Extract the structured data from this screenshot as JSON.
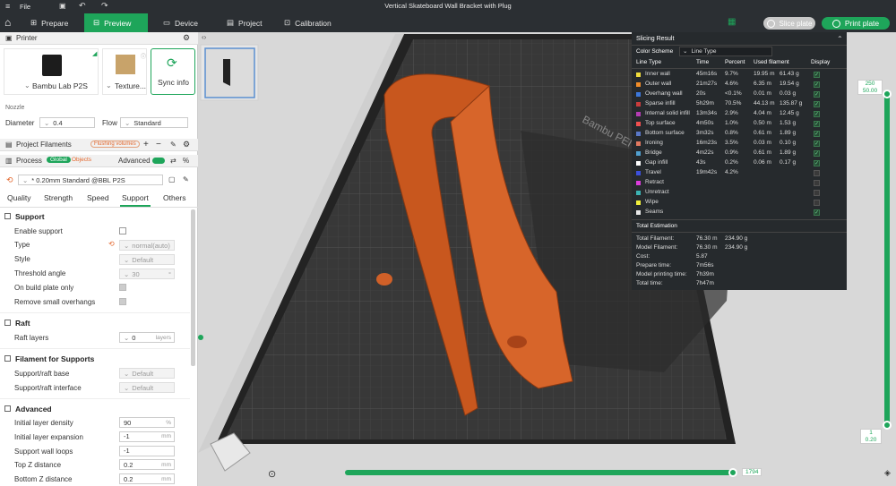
{
  "titlebar": {
    "title": "Vertical Skateboard Wall Bracket with Plug",
    "file_menu": "File"
  },
  "nav": {
    "tabs": [
      "Prepare",
      "Preview",
      "Device",
      "Project",
      "Calibration"
    ],
    "slice_plate": "Slice plate",
    "print_plate": "Print plate"
  },
  "printer": {
    "header": "Printer",
    "name": "Bambu Lab P2S",
    "plate": "Texture...",
    "sync": "Sync info",
    "nozzle_label": "Nozzle",
    "diameter_label": "Diameter",
    "diameter_value": "0.4",
    "flow_label": "Flow",
    "flow_value": "Standard"
  },
  "filaments": {
    "header": "Project Filaments",
    "flushing": "Flushing volumes",
    "add": "+",
    "remove": "−"
  },
  "process": {
    "header": "Process",
    "global": "Global",
    "objects": "Objects",
    "advanced": "Advanced",
    "preset": "* 0.20mm Standard @BBL P2S",
    "tabs": [
      "Quality",
      "Strength",
      "Speed",
      "Support",
      "Others"
    ]
  },
  "support": {
    "group": "Support",
    "enable": "Enable support",
    "type_label": "Type",
    "type_value": "normal(auto)",
    "style_label": "Style",
    "style_value": "Default",
    "threshold_label": "Threshold angle",
    "threshold_value": "30",
    "threshold_unit": "°",
    "build_plate": "On build plate only",
    "remove_small": "Remove small overhangs"
  },
  "raft": {
    "group": "Raft",
    "layers_label": "Raft layers",
    "layers_value": "0",
    "layers_unit": "layers"
  },
  "filament_supports": {
    "group": "Filament for Supports",
    "base_label": "Support/raft base",
    "base_value": "Default",
    "interface_label": "Support/raft interface",
    "interface_value": "Default"
  },
  "advanced": {
    "group": "Advanced",
    "rows": [
      {
        "label": "Initial layer density",
        "value": "90",
        "unit": "%"
      },
      {
        "label": "Initial layer expansion",
        "value": "-1",
        "unit": "mm"
      },
      {
        "label": "Support wall loops",
        "value": "-1",
        "unit": ""
      },
      {
        "label": "Top Z distance",
        "value": "0.2",
        "unit": "mm"
      },
      {
        "label": "Bottom Z distance",
        "value": "0.2",
        "unit": "mm"
      }
    ]
  },
  "slicing": {
    "title": "Slicing Result",
    "color_scheme_label": "Color Scheme",
    "color_scheme_value": "Line Type",
    "headers": [
      "Line Type",
      "Time",
      "Percent",
      "Used filament",
      "Display"
    ],
    "rows": [
      {
        "name": "Inner wall",
        "color": "#f0dc3c",
        "time": "45m16s",
        "percent": "9.7%",
        "len": "19.95 m",
        "weight": "61.43 g",
        "on": true
      },
      {
        "name": "Outer wall",
        "color": "#f08c28",
        "time": "21m27s",
        "percent": "4.6%",
        "len": "6.35 m",
        "weight": "19.54 g",
        "on": true
      },
      {
        "name": "Overhang wall",
        "color": "#3c78dc",
        "time": "20s",
        "percent": "<0.1%",
        "len": "0.01 m",
        "weight": "0.03 g",
        "on": true
      },
      {
        "name": "Sparse infill",
        "color": "#c83c3c",
        "time": "5h29m",
        "percent": "70.5%",
        "len": "44.13 m",
        "weight": "135.87 g",
        "on": true
      },
      {
        "name": "Internal solid infill",
        "color": "#b43cb4",
        "time": "13m34s",
        "percent": "2.9%",
        "len": "4.04 m",
        "weight": "12.45 g",
        "on": true
      },
      {
        "name": "Top surface",
        "color": "#f05050",
        "time": "4m50s",
        "percent": "1.0%",
        "len": "0.50 m",
        "weight": "1.53 g",
        "on": true
      },
      {
        "name": "Bottom surface",
        "color": "#5a78c8",
        "time": "3m32s",
        "percent": "0.8%",
        "len": "0.61 m",
        "weight": "1.89 g",
        "on": true
      },
      {
        "name": "Ironing",
        "color": "#e07860",
        "time": "16m23s",
        "percent": "3.5%",
        "len": "0.03 m",
        "weight": "0.10 g",
        "on": true
      },
      {
        "name": "Bridge",
        "color": "#50a0d0",
        "time": "4m22s",
        "percent": "0.9%",
        "len": "0.61 m",
        "weight": "1.89 g",
        "on": true
      },
      {
        "name": "Gap infill",
        "color": "#ffffff",
        "time": "43s",
        "percent": "0.2%",
        "len": "0.06 m",
        "weight": "0.17 g",
        "on": true
      },
      {
        "name": "Travel",
        "color": "#3c50dc",
        "time": "19m42s",
        "percent": "4.2%",
        "len": "",
        "weight": "",
        "on": false
      },
      {
        "name": "Retract",
        "color": "#dc3cdc",
        "time": "",
        "percent": "",
        "len": "",
        "weight": "",
        "on": false
      },
      {
        "name": "Unretract",
        "color": "#3cb4b4",
        "time": "",
        "percent": "",
        "len": "",
        "weight": "",
        "on": false
      },
      {
        "name": "Wipe",
        "color": "#f0f03c",
        "time": "",
        "percent": "",
        "len": "",
        "weight": "",
        "on": false
      },
      {
        "name": "Seams",
        "color": "#e8e8e8",
        "time": "",
        "percent": "",
        "len": "",
        "weight": "",
        "on": true
      }
    ],
    "estimation_title": "Total Estimation",
    "estimation": [
      {
        "label": "Total Filament:",
        "a": "76.30 m",
        "b": "234.90 g"
      },
      {
        "label": "Model Filament:",
        "a": "76.30 m",
        "b": "234.90 g"
      },
      {
        "label": "Cost:",
        "a": "5.87",
        "b": ""
      },
      {
        "label": "Prepare time:",
        "a": "7m56s",
        "b": ""
      },
      {
        "label": "Model printing time:",
        "a": "7h39m",
        "b": ""
      },
      {
        "label": "Total time:",
        "a": "7h47m",
        "b": ""
      }
    ]
  },
  "layer_slider": {
    "top_layer": "250",
    "top_height": "50.00",
    "bottom_layer": "1",
    "bottom_height": "0.20"
  },
  "move_slider": {
    "value": "1794"
  },
  "plate_label": "Bambu PEI Plate"
}
